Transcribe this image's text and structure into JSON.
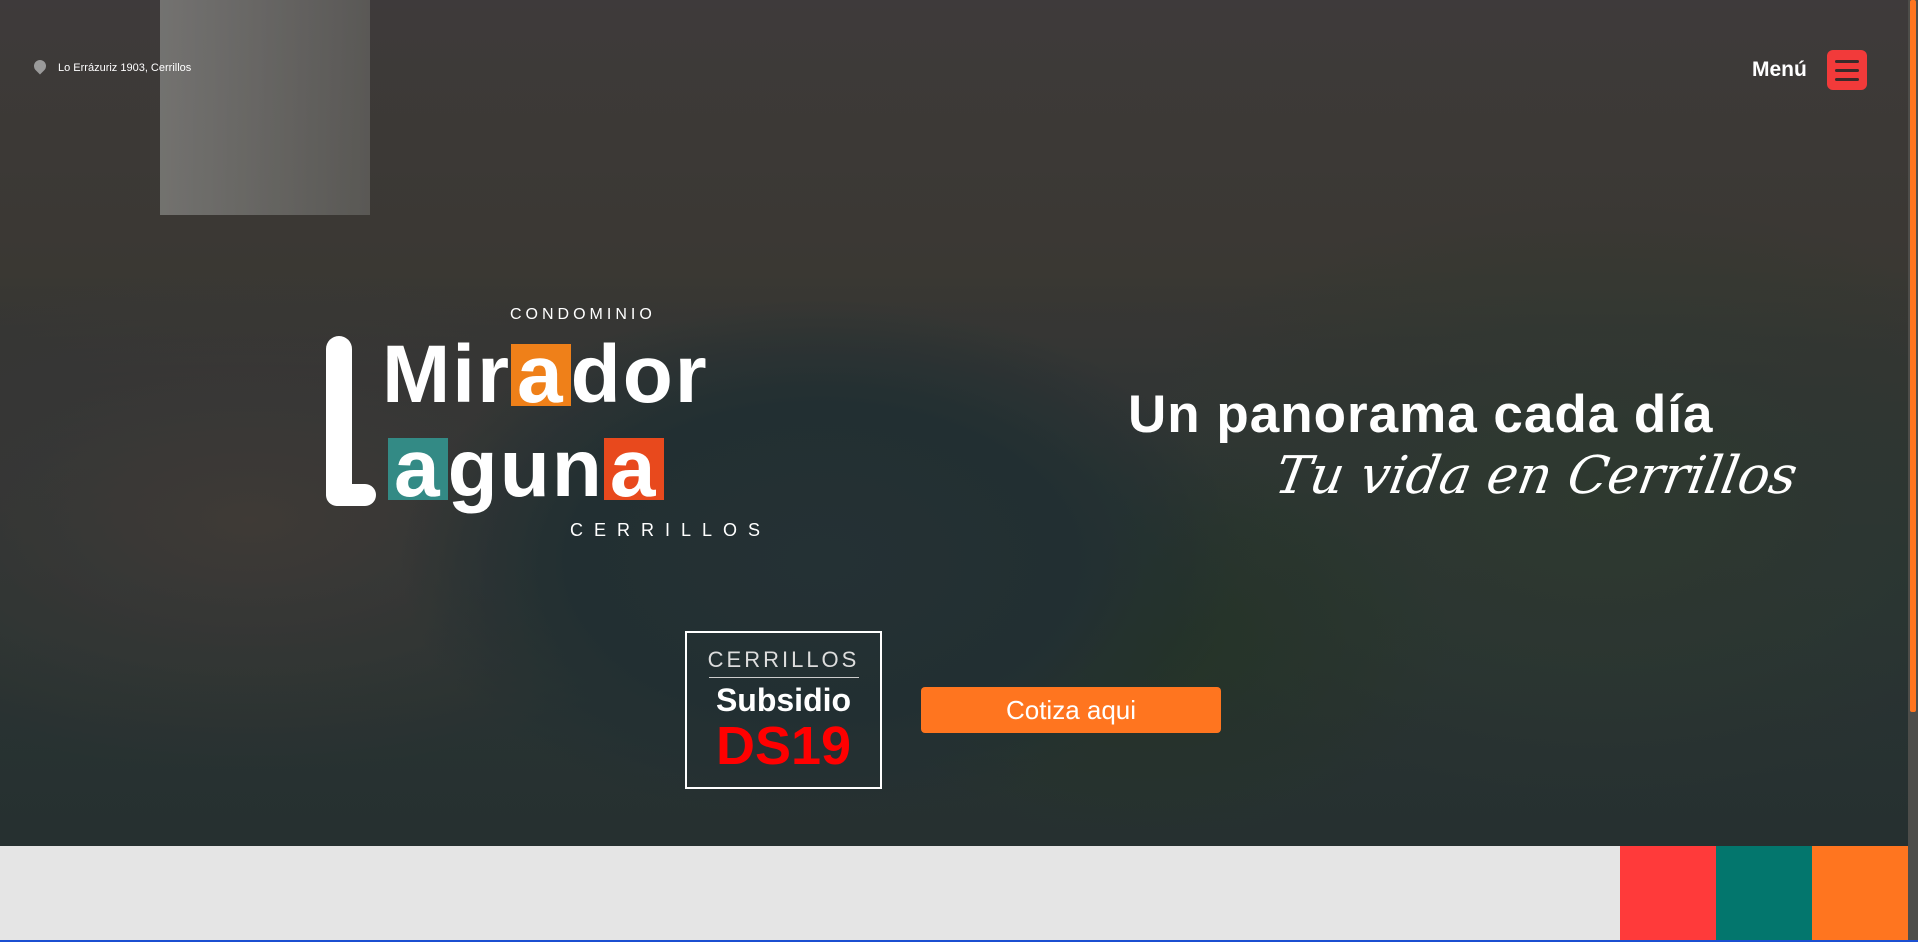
{
  "header": {
    "location": "Lo Errázuriz 1903, Cerrillos",
    "menu_label": "Menú"
  },
  "logo": {
    "top": "CONDOMINIO",
    "word1": [
      "Mir",
      "a",
      "dor"
    ],
    "word2": [
      "a",
      "gun",
      "a"
    ],
    "bottom": "CERRILLOS"
  },
  "hero": {
    "headline": "Un panorama cada día",
    "tagline": "Tu vida en Cerrillos"
  },
  "badge": {
    "city": "CERRILLOS",
    "subsidy": "Subsidio",
    "program": "DS19"
  },
  "cta": {
    "label": "Cotiza aqui"
  },
  "colors": {
    "red": "#ff3a3a",
    "teal": "#03766d",
    "orange": "#ff751f",
    "logo_orange": "#ef8019",
    "logo_teal": "#338a85",
    "logo_red": "#e8491d"
  }
}
